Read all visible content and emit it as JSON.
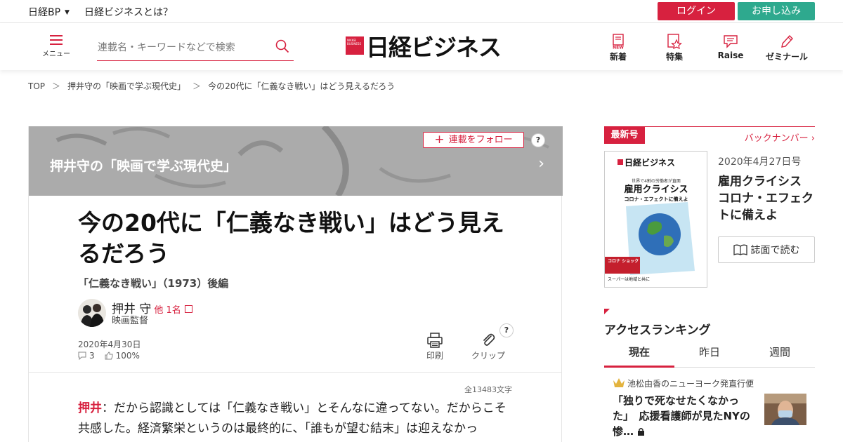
{
  "topbar": {
    "nikkei_bp": "日経BP",
    "about": "日経ビジネスとは？",
    "login": "ログイン",
    "apply": "お申し込み"
  },
  "header": {
    "menu_label": "メニュー",
    "search_placeholder": "連載名・キーワードなどで検索",
    "logo_text": "日経ビジネス",
    "nav": [
      {
        "label": "新着",
        "icon": "new-doc-icon"
      },
      {
        "label": "特集",
        "icon": "feature-star-icon"
      },
      {
        "label": "Raise",
        "icon": "raise-chat-icon"
      },
      {
        "label": "ゼミナール",
        "icon": "pen-icon"
      }
    ]
  },
  "breadcrumb": [
    "TOP",
    "押井守の「映画で学ぶ現代史」",
    "今の20代に「仁義なき戦い」はどう見えるだろう"
  ],
  "article": {
    "series_title": "押井守の「映画で学ぶ現代史」",
    "follow_label": "連載をフォロー",
    "help": "?",
    "headline": "今の20代に「仁義なき戦い」はどう見えるだろう",
    "subtitle": "「仁義なき戦い」（1973）後編",
    "author": "押井 守",
    "author_others": "他 1名",
    "author_role": "映画監督",
    "date": "2020年4月30日",
    "comments": "3",
    "likes": "100%",
    "print_label": "印刷",
    "clip_label": "クリップ",
    "word_count": "全13483文字",
    "speaker": "押井",
    "body": "：だから認識としては「仁義なき戦い」とそんなに違ってない。だからこそ共感した。経済繁栄というのは最終的に、「誰もが望む結末」は迎えなかっ"
  },
  "sidebar": {
    "latest_tag": "最新号",
    "back_numbers": "バックナンバー",
    "issue_date": "2020年4月27日号",
    "issue_title": "雇用クライシス コロナ・エフェクトに備えよ",
    "read_label": "誌面で読む",
    "cover": {
      "logo": "日経ビジネス",
      "kicker": "世界で4割の労働者が直面",
      "title": "雇用クライシス",
      "subtitle": "コロナ・エフェクトに備えよ",
      "badge": "コロナ ショック",
      "bottom": "スーパーは地域と共に"
    },
    "ranking_title": "アクセスランキング",
    "ranking_tabs": [
      "現在",
      "昨日",
      "週間"
    ],
    "rank_series": "池松由香のニューヨーク発直行便",
    "rank_item": "「独りで死なせたくなかった」　応援看護師が見たNYの惨…"
  },
  "colors": {
    "brand_red": "#d7213f",
    "apply_green": "#2ea98e"
  }
}
